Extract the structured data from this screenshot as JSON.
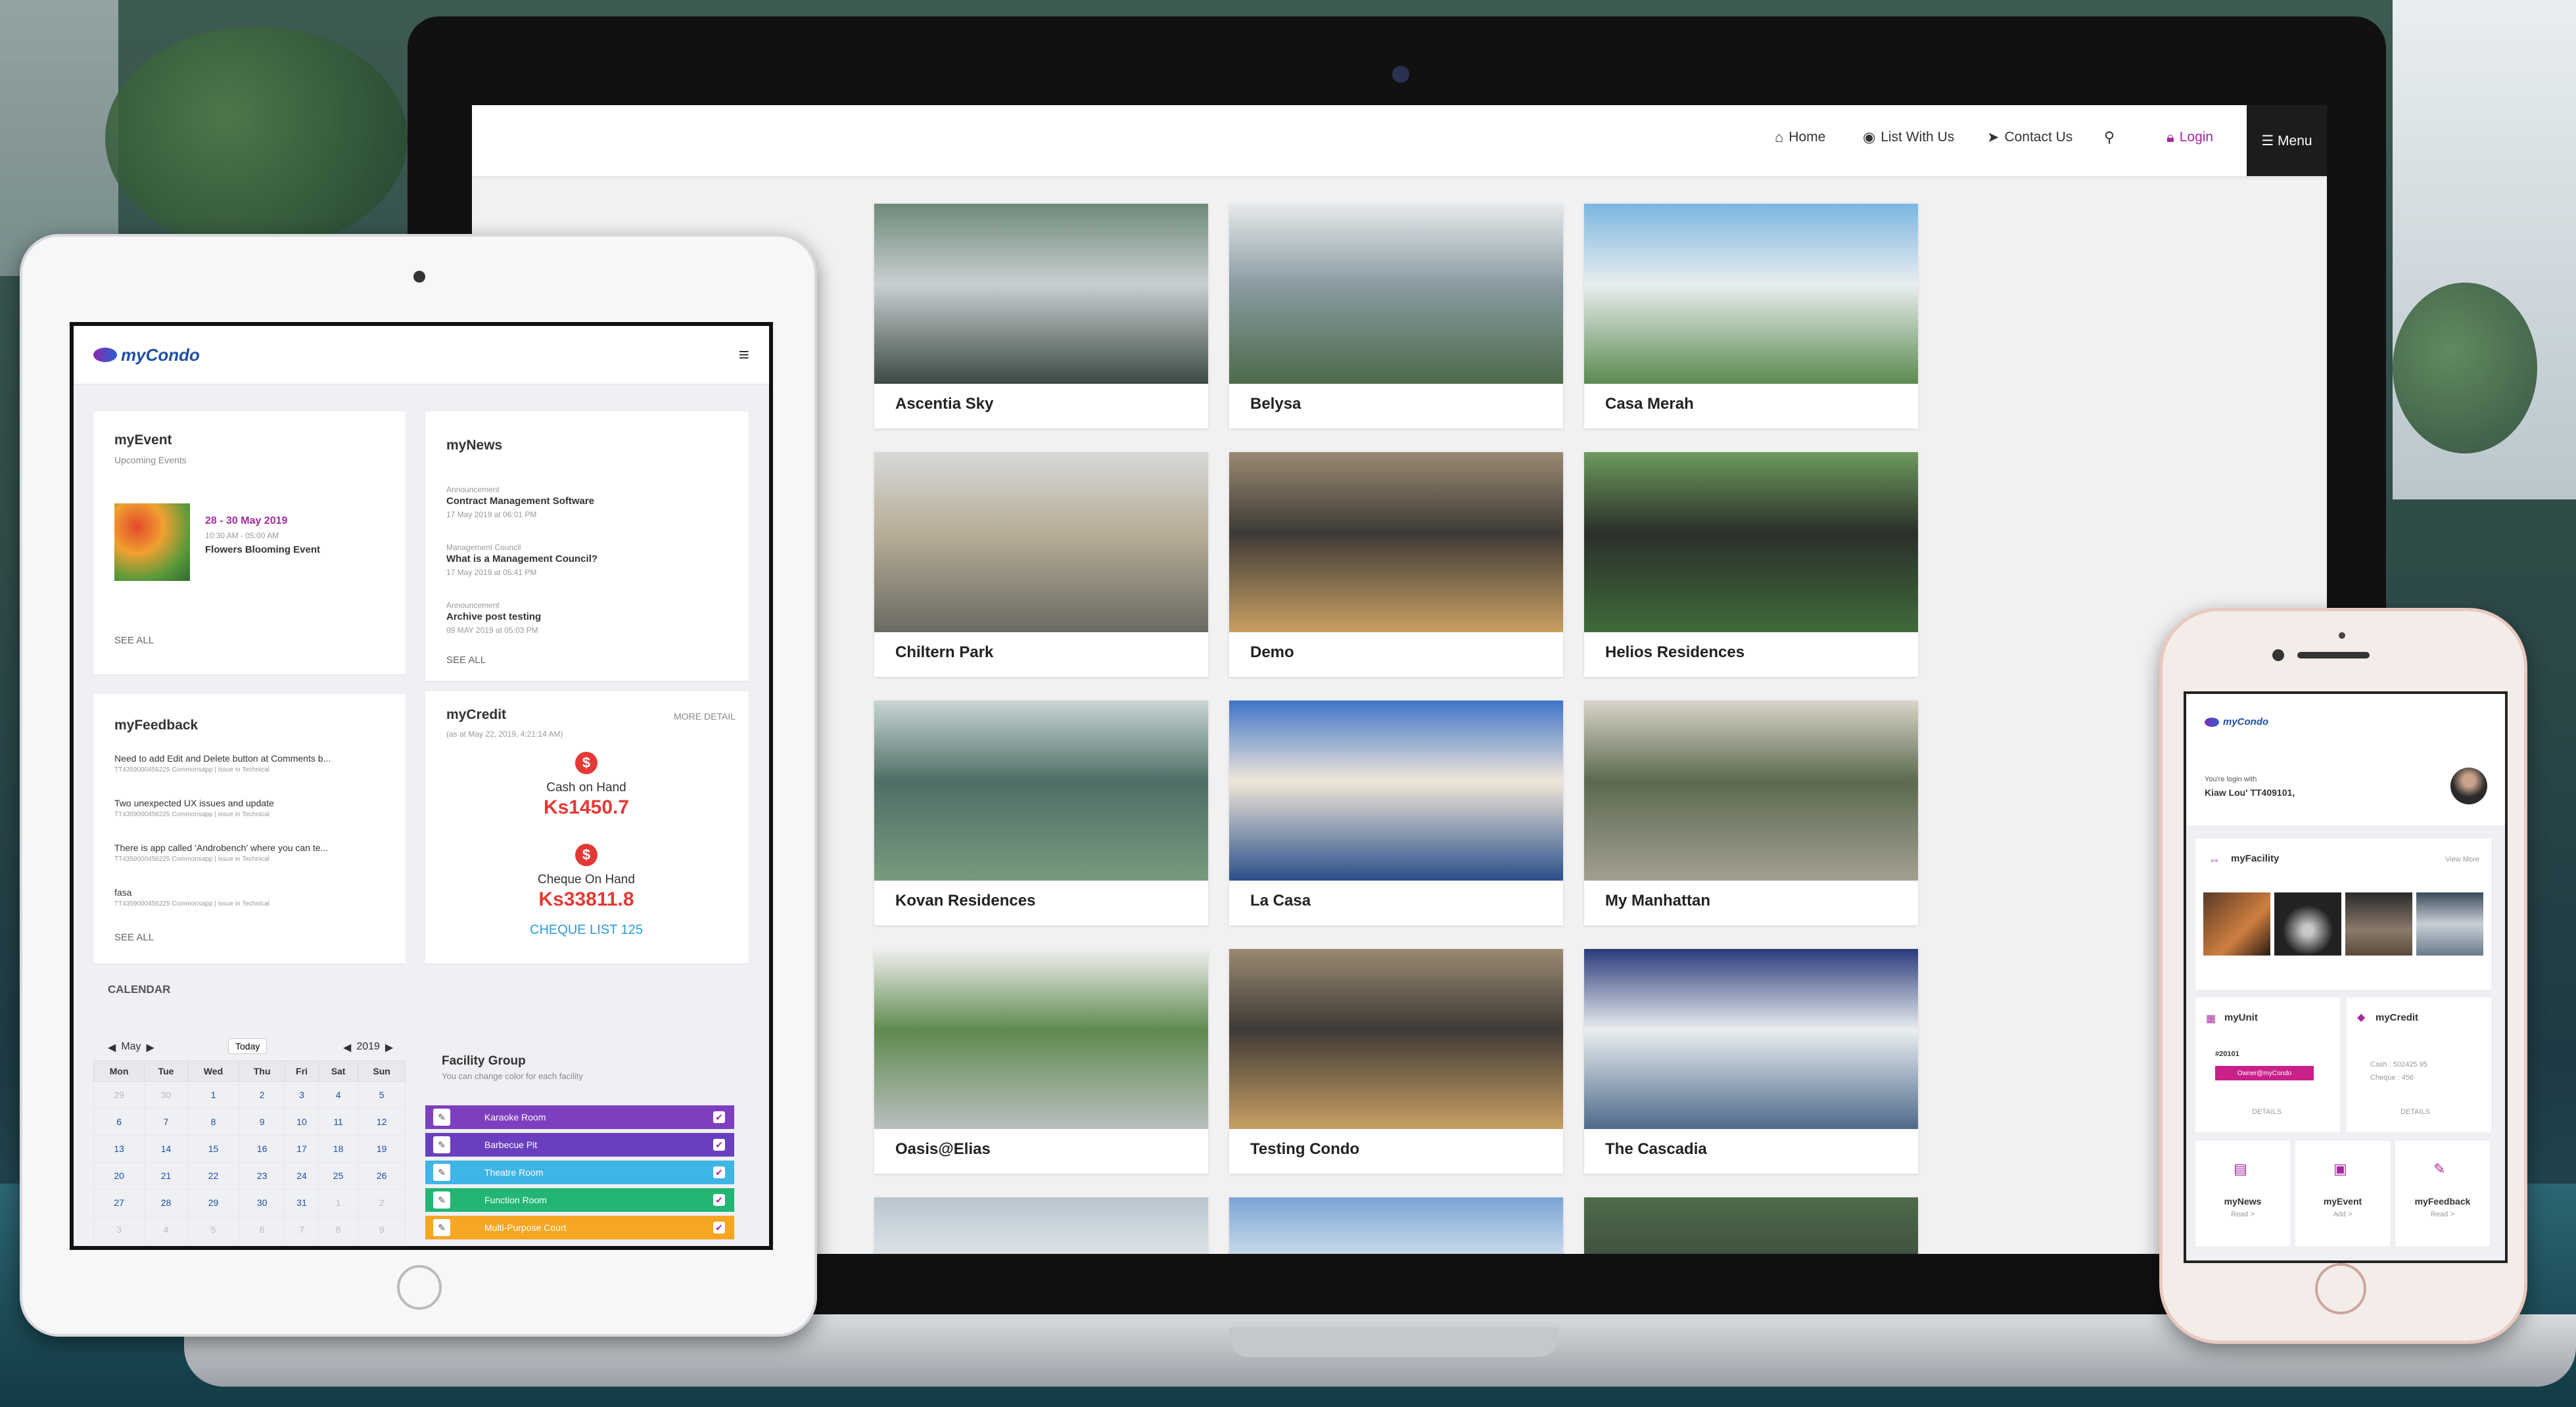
{
  "website": {
    "nav": [
      {
        "icon": "home-icon",
        "glyph": "⌂",
        "label": "Home"
      },
      {
        "icon": "eye-icon",
        "glyph": "◉",
        "label": "List With Us"
      },
      {
        "icon": "send-icon",
        "glyph": "➤",
        "label": "Contact Us"
      },
      {
        "icon": "search-icon",
        "glyph": "⚲",
        "label": ""
      }
    ],
    "login_label": "Login",
    "menu_label": "☰ Menu",
    "listings": [
      {
        "name": "Ascentia Sky",
        "colors": [
          "#6f8a7a",
          "#c9cfd1",
          "#3b4a44"
        ]
      },
      {
        "name": "Belysa",
        "colors": [
          "#e6e9ec",
          "#8a9ba2",
          "#4d6a4a"
        ]
      },
      {
        "name": "Casa Merah",
        "colors": [
          "#7bb6e0",
          "#e9eef0",
          "#5b8a4f"
        ]
      },
      {
        "name": "Chiltern Park",
        "colors": [
          "#d7d9d8",
          "#b8ad98",
          "#6a6a62"
        ]
      },
      {
        "name": "Demo",
        "colors": [
          "#9a8a72",
          "#3e3a36",
          "#c9a063"
        ]
      },
      {
        "name": "Helios Residences",
        "colors": [
          "#6d9a5e",
          "#2a2f2a",
          "#3f6a3a"
        ]
      },
      {
        "name": "Kovan Residences",
        "colors": [
          "#c8d6d4",
          "#4f6e66",
          "#7a9a7e"
        ]
      },
      {
        "name": "La Casa",
        "colors": [
          "#3f74c8",
          "#f0e6d8",
          "#2a4f8a"
        ]
      },
      {
        "name": "My Manhattan",
        "colors": [
          "#d9d4c8",
          "#5b6a4f",
          "#a39f92"
        ]
      },
      {
        "name": "Oasis@Elias",
        "colors": [
          "#f0f0ee",
          "#5f8a4f",
          "#b9c0bf"
        ]
      },
      {
        "name": "Testing Condo",
        "colors": [
          "#9a8a72",
          "#3e3a36",
          "#c9a063"
        ]
      },
      {
        "name": "The Cascadia",
        "colors": [
          "#2a3a7a",
          "#e9eef0",
          "#4f6a8a"
        ]
      },
      {
        "name": "",
        "colors": [
          "#b9c6d0",
          "#e9eef0",
          "#7d8f9a"
        ]
      },
      {
        "name": "",
        "colors": [
          "#7ba5d6",
          "#e9eef0",
          "#9aaab5"
        ]
      },
      {
        "name": "",
        "colors": [
          "#4f6a4a",
          "#3a4a3a",
          "#2a3a2a"
        ]
      }
    ]
  },
  "tablet": {
    "brand": "myCondo",
    "event": {
      "title": "myEvent",
      "subtitle": "Upcoming Events",
      "date": "28 - 30 May 2019",
      "time": "10:30 AM - 05:00 AM",
      "name": "Flowers Blooming Event",
      "see_all": "SEE ALL"
    },
    "news": {
      "title": "myNews",
      "see_all": "SEE ALL",
      "items": [
        {
          "category": "Announcement",
          "title": "Contract Management Software",
          "date": "17 May 2019 at 06:01 PM"
        },
        {
          "category": "Management Council",
          "title": "What is a Management Council?",
          "date": "17 May 2019 at 05:41 PM"
        },
        {
          "category": "Announcement",
          "title": "Archive post testing",
          "date": "09 MAY 2019 at 05:03 PM"
        }
      ]
    },
    "feedback": {
      "title": "myFeedback",
      "see_all": "SEE ALL",
      "items": [
        {
          "title": "Need to add Edit and Delete button at Comments b...",
          "meta": "TT4359000456225 Commonsapp | issue in Technical"
        },
        {
          "title": "Two unexpected UX issues and update",
          "meta": "TT4359000456225 Commonsapp | issue in Technical"
        },
        {
          "title": "There is app called 'Androbench' where you can te...",
          "meta": "TT4359000456225 Commonsapp | issue in Technical"
        },
        {
          "title": "fasa",
          "meta": "TT4359000456225 Commonsapp | issue in Technical"
        }
      ]
    },
    "credit": {
      "title": "myCredit",
      "more": "MORE DETAIL",
      "asof": "(as at May 22, 2019, 4:21:14 AM)",
      "cash_label": "Cash on Hand",
      "cash_value": "Ks1450.7",
      "cheque_label": "Cheque On Hand",
      "cheque_value": "Ks33811.8",
      "cheque_list": "CHEQUE LIST 125"
    },
    "calendar": {
      "title": "CALENDAR",
      "month": "May",
      "year": "2019",
      "today": "Today",
      "days": [
        "Mon",
        "Tue",
        "Wed",
        "Thu",
        "Fri",
        "Sat",
        "Sun"
      ],
      "weeks": [
        [
          "29",
          "30",
          "1",
          "2",
          "3",
          "4",
          "5"
        ],
        [
          "6",
          "7",
          "8",
          "9",
          "10",
          "11",
          "12"
        ],
        [
          "13",
          "14",
          "15",
          "16",
          "17",
          "18",
          "19"
        ],
        [
          "20",
          "21",
          "22",
          "23",
          "24",
          "25",
          "26"
        ],
        [
          "27",
          "28",
          "29",
          "30",
          "31",
          "1",
          "2"
        ],
        [
          "3",
          "4",
          "5",
          "6",
          "7",
          "8",
          "9"
        ]
      ]
    },
    "facility_group": {
      "title": "Facility Group",
      "subtitle": "You can change color for each facility",
      "items": [
        {
          "label": "Karaoke Room",
          "color": "#7d3fbf"
        },
        {
          "label": "Barbecue Pit",
          "color": "#6a3fbf"
        },
        {
          "label": "Theatre Room",
          "color": "#3fb5e6"
        },
        {
          "label": "Function Room",
          "color": "#22b573"
        },
        {
          "label": "Multi-Purpose Court",
          "color": "#f5a623"
        }
      ]
    }
  },
  "phone": {
    "brand": "myCondo",
    "login_line": "You're login with",
    "user": "Kiaw Lou' TT409101,",
    "facility_title": "myFacility",
    "view_more": "View More",
    "unit_title": "myUnit",
    "unit_no": "#20101",
    "unit_tag": "Owner@myCondo",
    "unit_detail": "DETAILS",
    "credit_title": "myCredit",
    "credit_cash": "Cash : 502425.95",
    "credit_cheque": "Cheque : 456",
    "credit_detail": "DETAILS",
    "tiles": [
      {
        "label": "myNews",
        "sub": "Read >"
      },
      {
        "label": "myEvent",
        "sub": "Add >"
      },
      {
        "label": "myFeedback",
        "sub": "Read >"
      }
    ]
  },
  "colors": {
    "brand_purple": "#a52aa0",
    "brand_blue": "#1f4fa4",
    "credit_red": "#e53935"
  }
}
